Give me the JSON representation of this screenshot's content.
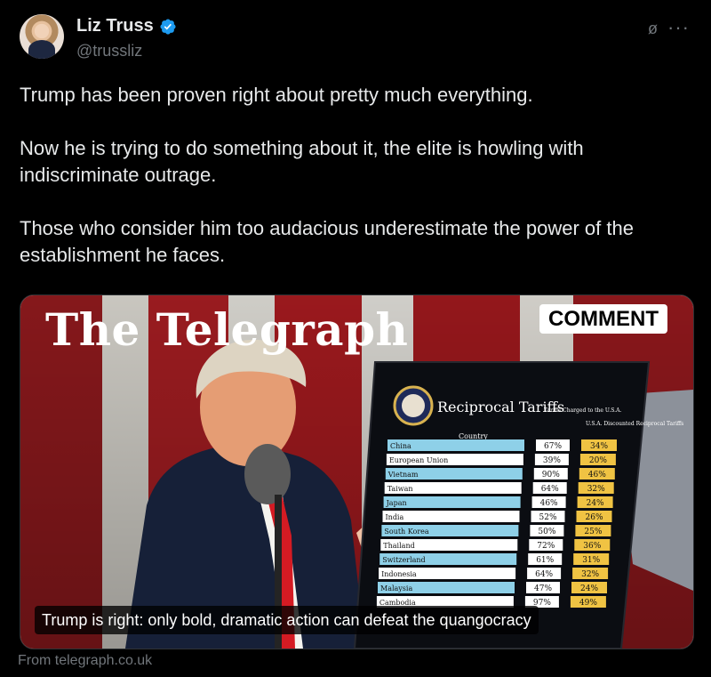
{
  "author": {
    "name": "Liz Truss",
    "handle": "@trussliz",
    "verified_color": "#1d9bf0"
  },
  "tweet": {
    "text": "Trump has been proven right about pretty much everything.\n\nNow he is trying to do something about it, the elite is howling with indiscriminate outrage.\n\nThose who consider him too audacious underestimate the power of the establishment he faces."
  },
  "card": {
    "publication": "The Telegraph",
    "badge": "COMMENT",
    "caption": "Trump is right: only bold, dramatic action can defeat the quangocracy",
    "source": "From telegraph.co.uk",
    "board": {
      "title": "Reciprocal Tariffs",
      "header_country": "Country",
      "header_charged": "Tariffs Charged to the U.S.A.",
      "header_discounted": "U.S.A. Discounted Reciprocal Tariffs",
      "rows": [
        {
          "country": "China",
          "charged": "67%",
          "reciprocal": "34%"
        },
        {
          "country": "European Union",
          "charged": "39%",
          "reciprocal": "20%"
        },
        {
          "country": "Vietnam",
          "charged": "90%",
          "reciprocal": "46%"
        },
        {
          "country": "Taiwan",
          "charged": "64%",
          "reciprocal": "32%"
        },
        {
          "country": "Japan",
          "charged": "46%",
          "reciprocal": "24%"
        },
        {
          "country": "India",
          "charged": "52%",
          "reciprocal": "26%"
        },
        {
          "country": "South Korea",
          "charged": "50%",
          "reciprocal": "25%"
        },
        {
          "country": "Thailand",
          "charged": "72%",
          "reciprocal": "36%"
        },
        {
          "country": "Switzerland",
          "charged": "61%",
          "reciprocal": "31%"
        },
        {
          "country": "Indonesia",
          "charged": "64%",
          "reciprocal": "32%"
        },
        {
          "country": "Malaysia",
          "charged": "47%",
          "reciprocal": "24%"
        },
        {
          "country": "Cambodia",
          "charged": "97%",
          "reciprocal": "49%"
        }
      ]
    }
  },
  "icons": {
    "grok": "grok-icon",
    "more": "more-icon"
  }
}
